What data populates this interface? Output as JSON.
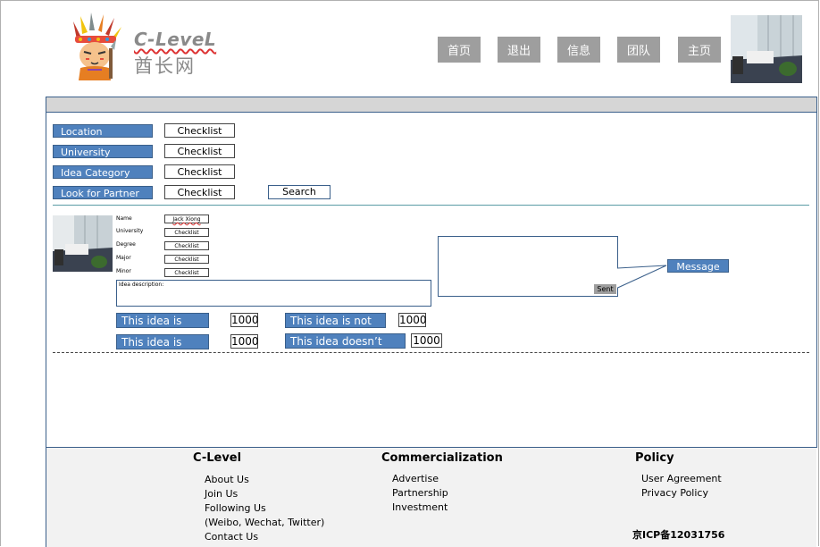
{
  "brand": {
    "name_en": "C-LeveL",
    "name_cn": "酋长网"
  },
  "nav": {
    "items": [
      "首页",
      "退出",
      "信息",
      "团队",
      "主页"
    ]
  },
  "filters": [
    {
      "label": "Location",
      "value": "Checklist"
    },
    {
      "label": "University",
      "value": "Checklist"
    },
    {
      "label": "Idea Category",
      "value": "Checklist"
    },
    {
      "label": "Look for Partner",
      "value": "Checklist"
    }
  ],
  "search": {
    "label": "Search"
  },
  "profile": {
    "fields": [
      {
        "label": "Name",
        "value": "Jack Xiong"
      },
      {
        "label": "University",
        "value": "Checklist"
      },
      {
        "label": "Degree",
        "value": "Checklist"
      },
      {
        "label": "Major",
        "value": "Checklist"
      },
      {
        "label": "Minor",
        "value": "Checklist"
      }
    ],
    "idea_label": "Idea description:"
  },
  "messaging": {
    "sent_label": "Sent",
    "message_label": "Message"
  },
  "votes": [
    {
      "label": "This idea is great",
      "count": "1000"
    },
    {
      "label": "This idea is not bad",
      "count": "1000"
    },
    {
      "label": "This idea is good",
      "count": "1000"
    },
    {
      "label": "This idea doesn’t work",
      "count": "1000"
    }
  ],
  "footer": {
    "col1": {
      "heading": "C-Level",
      "links": [
        "About Us",
        "Join Us",
        "Following Us",
        "(Weibo, Wechat, Twitter)",
        "Contact Us"
      ]
    },
    "col2": {
      "heading": "Commercialization",
      "links": [
        "Advertise",
        "Partnership",
        "Investment"
      ]
    },
    "col3": {
      "heading": "Policy",
      "links": [
        "User Agreement",
        "Privacy Policy"
      ]
    },
    "icp": "京ICP备12031756"
  },
  "colors": {
    "accent": "#4f81bd",
    "nav_gray": "#9e9e9e",
    "border": "#3a5f8a",
    "footer_bg": "#f2f2f2"
  }
}
